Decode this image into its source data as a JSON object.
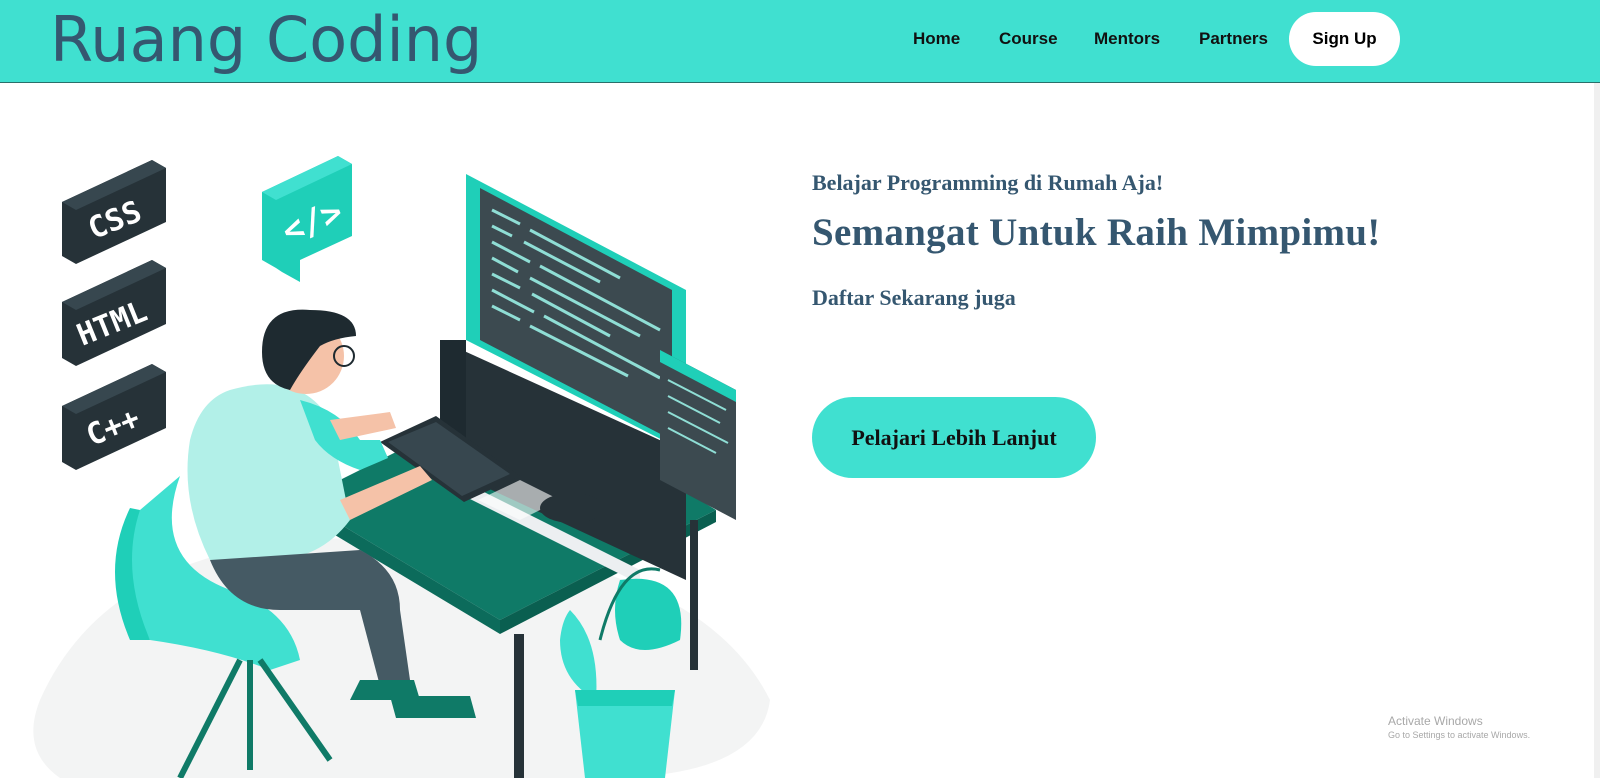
{
  "header": {
    "brand": "Ruang Coding",
    "nav": [
      {
        "label": "Home"
      },
      {
        "label": "Course"
      },
      {
        "label": "Mentors"
      },
      {
        "label": "Partners"
      }
    ],
    "signup_label": "Sign Up"
  },
  "hero": {
    "subtitle": "Belajar Programming di Rumah Aja!",
    "title": "Semangat Untuk Raih Mimpimu!",
    "tagline": "Daftar Sekarang juga",
    "cta_label": "Pelajari Lebih Lanjut"
  },
  "illustration": {
    "badges": [
      "CSS",
      "HTML",
      "C++"
    ],
    "code_symbol": "</>"
  },
  "windows_notice": {
    "line1": "Activate Windows",
    "line2": "Go to Settings to activate Windows."
  },
  "colors": {
    "accent": "#40e0d0",
    "brand_text": "#355770",
    "dark_green": "#0f7a67",
    "dark_slate": "#263238"
  }
}
